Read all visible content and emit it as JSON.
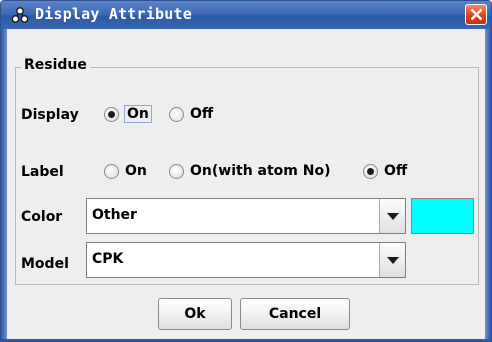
{
  "window": {
    "title": "Display Attribute",
    "icon": "molecule-icon",
    "close_icon": "close-x-icon"
  },
  "group": {
    "title": "Residue"
  },
  "display": {
    "label": "Display",
    "options": [
      {
        "label": "On",
        "selected": true
      },
      {
        "label": "Off",
        "selected": false
      }
    ]
  },
  "label_row": {
    "label": "Label",
    "options": [
      {
        "label": "On",
        "selected": false
      },
      {
        "label": "On(with atom No)",
        "selected": false
      },
      {
        "label": "Off",
        "selected": true
      }
    ]
  },
  "color": {
    "label": "Color",
    "value": "Other",
    "swatch": "#00ffff"
  },
  "model": {
    "label": "Model",
    "value": "CPK"
  },
  "buttons": {
    "ok": "Ok",
    "cancel": "Cancel"
  },
  "colors": {
    "titlebar": "#3f6bb3",
    "close": "#d8431e",
    "panel": "#eeeeee"
  }
}
